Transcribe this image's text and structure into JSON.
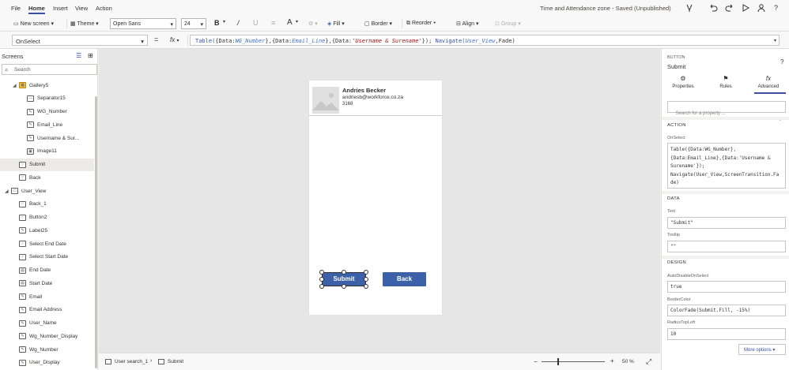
{
  "menu": {
    "items": [
      "File",
      "Home",
      "Insert",
      "View",
      "Action"
    ],
    "app_title": "Time and Attendance zone - Saved (Unpublished)"
  },
  "ribbon": {
    "new_screen": "New screen",
    "theme": "Theme",
    "font": "Open Sans",
    "font_size": "24",
    "bold": "B",
    "italic": "/",
    "fill": "Fill",
    "border": "Border",
    "reorder": "Reorder",
    "align": "Align",
    "group": "Group"
  },
  "formula_bar": {
    "property": "OnSelect",
    "equals": "=",
    "fx": "fx",
    "formula_parts": [
      {
        "t": "Table(",
        "c": "fn"
      },
      {
        "t": "{Data:",
        "c": "pl"
      },
      {
        "t": "WG_Number",
        "c": "id"
      },
      {
        "t": "},{Data:",
        "c": "pl"
      },
      {
        "t": "Email_Line",
        "c": "id"
      },
      {
        "t": "},{Data:",
        "c": "pl"
      },
      {
        "t": "'Username & Surename'",
        "c": "str"
      },
      {
        "t": "}); ",
        "c": "pl"
      },
      {
        "t": "Navigate(",
        "c": "fn"
      },
      {
        "t": "User_View",
        "c": "id"
      },
      {
        "t": ",Fade)",
        "c": "pl"
      }
    ]
  },
  "left_panel": {
    "header": "Screens",
    "search_placeholder": "Search",
    "items": [
      {
        "label": "Gallery5",
        "level": 1,
        "caret": "◢",
        "icon": "gallery"
      },
      {
        "label": "Separator15",
        "level": 2,
        "icon": "separator"
      },
      {
        "label": "WG_Number",
        "level": 2,
        "icon": "label"
      },
      {
        "label": "Email_Line",
        "level": 2,
        "icon": "label"
      },
      {
        "label": "Username & Sur...",
        "level": 2,
        "icon": "label"
      },
      {
        "label": "Image11",
        "level": 2,
        "icon": "image"
      },
      {
        "label": "Submit",
        "level": 1,
        "icon": "button",
        "selected": true
      },
      {
        "label": "Back",
        "level": 1,
        "icon": "button"
      },
      {
        "label": "User_View",
        "level": 0,
        "caret": "◢",
        "icon": "screen"
      },
      {
        "label": "Back_1",
        "level": 1,
        "icon": "button"
      },
      {
        "label": "Button2",
        "level": 1,
        "icon": "button"
      },
      {
        "label": "Label25",
        "level": 1,
        "icon": "label"
      },
      {
        "label": "Select End Date",
        "level": 1,
        "icon": "button"
      },
      {
        "label": "Select Start Date",
        "level": 1,
        "icon": "button"
      },
      {
        "label": "End Date",
        "level": 1,
        "icon": "date"
      },
      {
        "label": "Start Date",
        "level": 1,
        "icon": "date"
      },
      {
        "label": "Email",
        "level": 1,
        "icon": "label"
      },
      {
        "label": "Email Address",
        "level": 1,
        "icon": "label"
      },
      {
        "label": "User_Name",
        "level": 1,
        "icon": "label"
      },
      {
        "label": "Wg_Number_Display",
        "level": 1,
        "icon": "label"
      },
      {
        "label": "Wg_Number",
        "level": 1,
        "icon": "label"
      },
      {
        "label": "User_Display",
        "level": 1,
        "icon": "label"
      }
    ]
  },
  "canvas": {
    "gallery": {
      "name": "Andries Becker",
      "email": "andriesb@workforce.co.za",
      "number": "3168"
    },
    "submit_label": "Submit",
    "back_label": "Back",
    "accent": "#3c61a8"
  },
  "status_bar": {
    "screen_crumb": "User search_1",
    "control_crumb": "Submit",
    "zoom": "50 %",
    "zoom_minus": "−",
    "zoom_plus": "+"
  },
  "right_panel": {
    "type": "BUTTON",
    "name": "Submit",
    "tabs": [
      "Properties",
      "Rules",
      "Advanced"
    ],
    "search_placeholder": "Search for a property ...",
    "action_section": "ACTION",
    "onselect_label": "OnSelect",
    "onselect_value": "Table({Data:WG_Number},\n{Data:Email_Line},{Data:'Username &\nSurename'});\nNavigate(User_View,ScreenTransition.Fa\nde)",
    "data_section": "DATA",
    "text_label": "Text",
    "text_value": "\"Submit\"",
    "tooltip_label": "Tooltip",
    "tooltip_value": "\"\"",
    "design_section": "DESIGN",
    "autodisable_label": "AutoDisableOnSelect",
    "autodisable_value": "true",
    "bordercolor_label": "BorderColor",
    "bordercolor_value": "ColorFade(Submit.Fill, -15%)",
    "radius_label": "RadiusTopLeft",
    "radius_value": "10",
    "more_options": "More options"
  }
}
